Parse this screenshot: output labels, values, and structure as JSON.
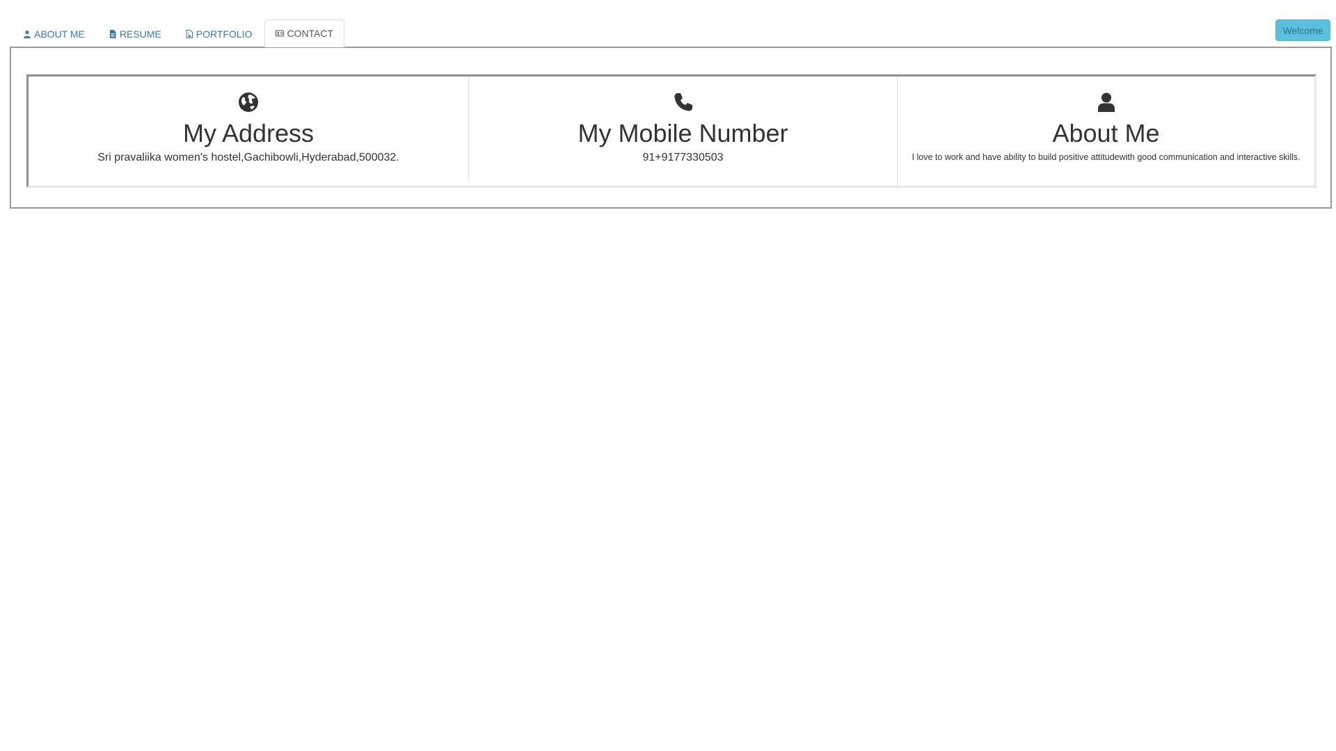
{
  "nav": {
    "tabs": [
      {
        "label": "ABOUT ME",
        "icon": "user-icon",
        "active": false
      },
      {
        "label": "RESUME",
        "icon": "file-icon",
        "active": false
      },
      {
        "label": "PORTFOLIO",
        "icon": "image-file-icon",
        "active": false
      },
      {
        "label": "CONTACT",
        "icon": "id-card-icon",
        "active": true
      }
    ]
  },
  "header": {
    "welcome_label": "Welcome"
  },
  "contact": {
    "cards": [
      {
        "icon": "globe-icon",
        "title": "My Address",
        "text": "Sri pravaliika women's hostel,Gachibowli,Hyderabad,500032."
      },
      {
        "icon": "phone-icon",
        "title": "My Mobile Number",
        "text": "91+9177330503"
      },
      {
        "icon": "user-icon",
        "title": "About Me",
        "text": "I love to work and have ability to build positive attitudewith good communication and interactive skills."
      }
    ]
  },
  "colors": {
    "link": "#337ab7",
    "welcome_bg": "#5bc0de",
    "text": "#333333"
  }
}
